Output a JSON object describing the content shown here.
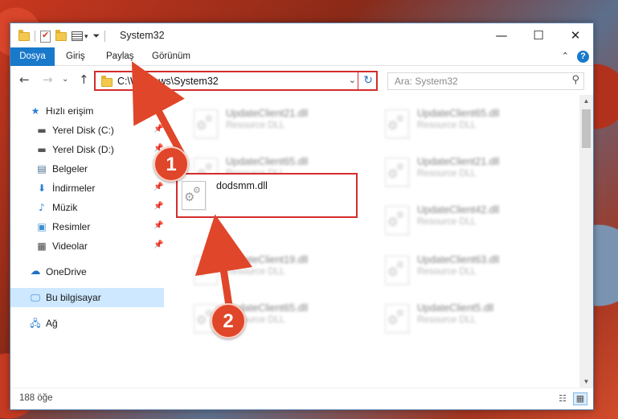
{
  "window": {
    "title": "System32",
    "controls": {
      "minimize": "—",
      "maximize": "☐",
      "close": "✕"
    }
  },
  "ribbon": {
    "tabs": [
      "Dosya",
      "Giriş",
      "Paylaş",
      "Görünüm"
    ],
    "active_tab": "Dosya",
    "help_label": "?"
  },
  "address": {
    "path": "C:\\Windows\\System32",
    "search_placeholder": "Ara: System32"
  },
  "navpane": {
    "quick_access": "Hızlı erişim",
    "pinned": [
      "Yerel Disk (C:)",
      "Yerel Disk (D:)",
      "Belgeler",
      "İndirmeler",
      "Müzik",
      "Resimler",
      "Videolar"
    ],
    "onedrive": "OneDrive",
    "this_pc": "Bu bilgisayar",
    "network": "Ağ"
  },
  "files": {
    "highlighted": {
      "name": "dodsmm.dll"
    },
    "blurred": [
      {
        "name": "UpdateClient21.dll",
        "type": "Resource DLL"
      },
      {
        "name": "UpdateClient65.dll",
        "type": "Resource DLL"
      },
      {
        "name": "UpdateClient65.dll",
        "type": "Resource DLL"
      },
      {
        "name": "UpdateClient21.dll",
        "type": "Resource DLL"
      },
      {
        "name": "UpdateClient42.dll",
        "type": "Resource DLL"
      },
      {
        "name": "UpdateClient19.dll",
        "type": "Resource DLL"
      },
      {
        "name": "UpdateClient63.dll",
        "type": "Resource DLL"
      },
      {
        "name": "UpdateClient65.dll",
        "type": "Resource DLL"
      },
      {
        "name": "UpdateClient5.dll",
        "type": "Resource DLL"
      }
    ]
  },
  "status": {
    "item_count": "188 öğe"
  },
  "annotations": {
    "step1": "1",
    "step2": "2",
    "color": "#e0462a"
  }
}
